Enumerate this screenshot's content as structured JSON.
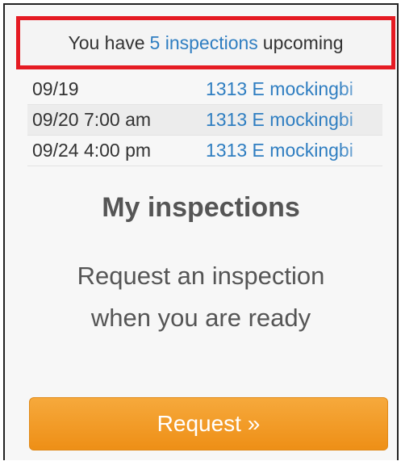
{
  "summary": {
    "prefix": "You have",
    "link": "5 inspections",
    "suffix": "upcoming"
  },
  "inspections": [
    {
      "date": "09/19",
      "address": "1313 E mockingbi"
    },
    {
      "date": "09/20 7:00 am",
      "address": "1313 E mockingbi"
    },
    {
      "date": "09/24 4:00 pm",
      "address": "1313 E mockingbi"
    }
  ],
  "section": {
    "title": "My inspections",
    "request_line1": "Request an inspection",
    "request_line2": "when you are ready"
  },
  "request_button": {
    "label": "Request »"
  },
  "colors": {
    "link": "#2f7ec1",
    "highlight_border": "#e51b23",
    "button": "#f29b26",
    "text": "#555555"
  }
}
